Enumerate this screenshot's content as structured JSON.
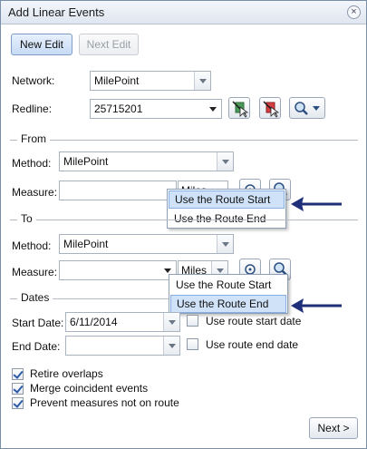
{
  "window": {
    "title": "Add Linear Events",
    "close_glyph": "×"
  },
  "toolbar": {
    "new_edit": "New Edit",
    "next_edit": "Next Edit"
  },
  "network": {
    "label": "Network:",
    "value": "MilePoint"
  },
  "redline": {
    "label": "Redline:",
    "value": "25715201"
  },
  "from": {
    "header": "From",
    "method_label": "Method:",
    "method_value": "MilePoint",
    "measure_label": "Measure:",
    "measure_value": "",
    "unit": "Miles",
    "popup": [
      "Use the Route Start",
      "Use the Route End"
    ]
  },
  "to": {
    "header": "To",
    "method_label": "Method:",
    "method_value": "MilePoint",
    "measure_label": "Measure:",
    "measure_value": "",
    "unit": "Miles",
    "popup": [
      "Use the Route Start",
      "Use the Route End"
    ]
  },
  "dates": {
    "header": "Dates",
    "start_label": "Start Date:",
    "start_value": "6/11/2014",
    "start_check": "Use route start date",
    "end_label": "End Date:",
    "end_value": "",
    "end_check": "Use route end date"
  },
  "options": {
    "retire": "Retire overlaps",
    "merge": "Merge coincident events",
    "prevent": "Prevent measures not on route"
  },
  "footer": {
    "next": "Next >"
  },
  "colors": {
    "accent": "#2b5aa8",
    "highlight": "#cfe2f8",
    "arrow": "#1f2f7a"
  }
}
